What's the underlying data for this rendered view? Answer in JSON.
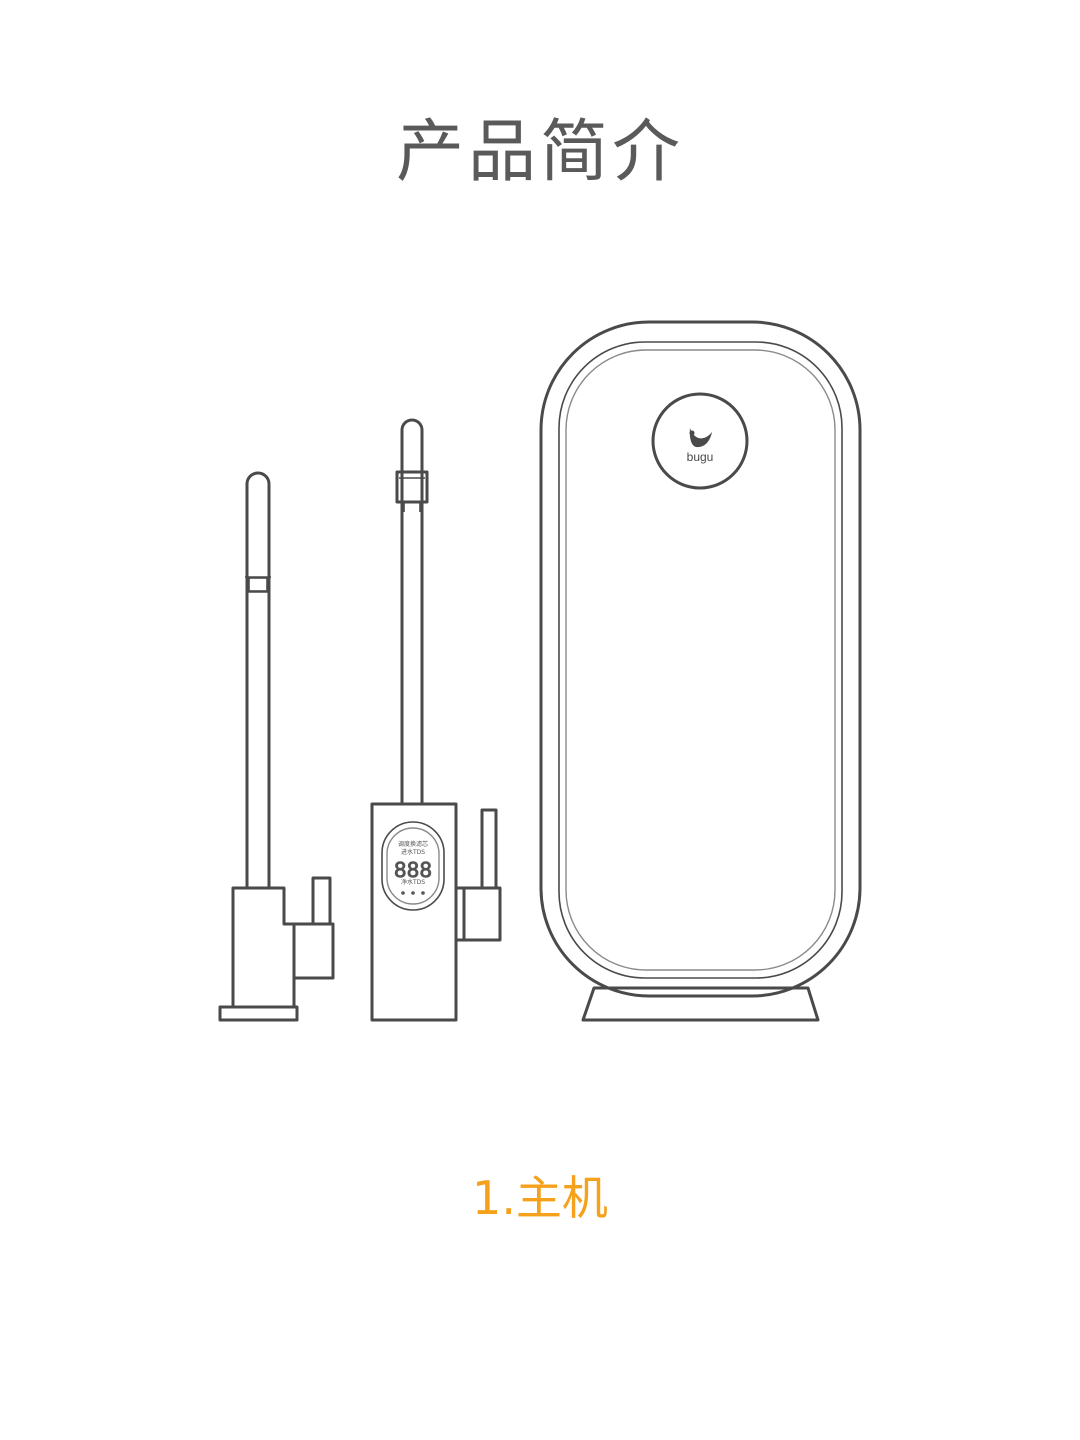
{
  "header": {
    "title": "产品简介"
  },
  "product": {
    "brand_logo_text": "bugu",
    "faucet_display": {
      "line1": "调度换滤芯",
      "line2": "进水TDS",
      "digits": "888",
      "line3": "净水TDS"
    }
  },
  "caption": {
    "label": "1.主机"
  }
}
